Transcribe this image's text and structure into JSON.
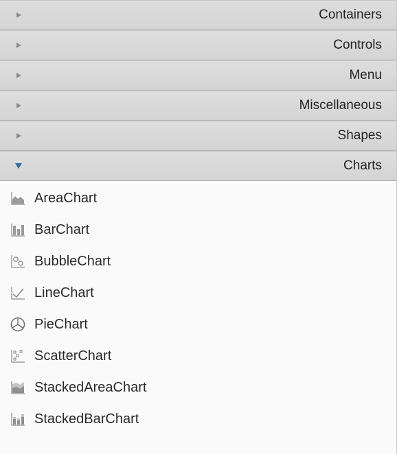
{
  "sections": [
    {
      "title": "Containers",
      "expanded": false
    },
    {
      "title": "Controls",
      "expanded": false
    },
    {
      "title": "Menu",
      "expanded": false
    },
    {
      "title": "Miscellaneous",
      "expanded": false
    },
    {
      "title": "Shapes",
      "expanded": false
    },
    {
      "title": "Charts",
      "expanded": true
    }
  ],
  "charts": {
    "items": [
      {
        "label": "AreaChart",
        "icon": "area-chart-icon"
      },
      {
        "label": "BarChart",
        "icon": "bar-chart-icon"
      },
      {
        "label": "BubbleChart",
        "icon": "bubble-chart-icon"
      },
      {
        "label": "LineChart",
        "icon": "line-chart-icon"
      },
      {
        "label": "PieChart",
        "icon": "pie-chart-icon"
      },
      {
        "label": "ScatterChart",
        "icon": "scatter-chart-icon"
      },
      {
        "label": "StackedAreaChart",
        "icon": "stacked-area-chart-icon"
      },
      {
        "label": "StackedBarChart",
        "icon": "stacked-bar-chart-icon"
      }
    ]
  },
  "colors": {
    "header_bg": "#d8d8d8",
    "expanded_arrow": "#2f6fa3",
    "collapsed_arrow": "#8c8c8c",
    "list_bg": "#fafafa"
  }
}
